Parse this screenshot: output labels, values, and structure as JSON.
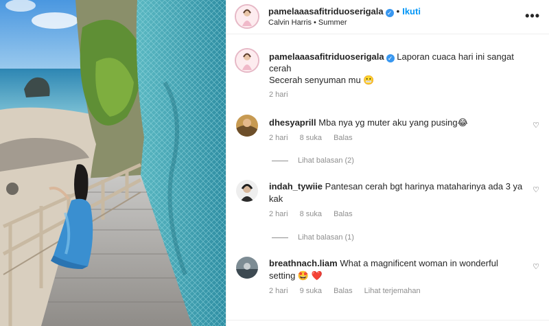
{
  "post": {
    "username": "pamelaaasafitriduoserigala",
    "follow_label": "Ikuti",
    "audio": "Calvin Harris • Summer",
    "more_icon": "more-horizontal-icon",
    "caption": {
      "text_line1": "Laporan cuaca hari ini sangat cerah",
      "text_line2": "Secerah senyuman mu 😬",
      "time": "2 hari"
    }
  },
  "comments": [
    {
      "username": "dhesyaprill",
      "text": "Mba nya yg muter aku yang pusing😂",
      "time": "2 hari",
      "likes": "8 suka",
      "reply_label": "Balas",
      "view_replies": "Lihat balasan (2)"
    },
    {
      "username": "indah_tywiie",
      "text": "Pantesan cerah bgt harinya mataharinya ada 3 ya kak",
      "time": "2 hari",
      "likes": "8 suka",
      "reply_label": "Balas",
      "view_replies": "Lihat balasan (1)"
    },
    {
      "username": "breathnach.liam",
      "text": "What a magnificent woman in wonderful setting 🤩 ❤️",
      "time": "2 hari",
      "likes": "9 suka",
      "reply_label": "Balas",
      "translate_label": "Lihat terjemahan"
    }
  ],
  "colors": {
    "accent": "#0095f6",
    "verified": "#3897f0",
    "muted": "#8e8e8e",
    "heart_red": "#ed4956"
  }
}
